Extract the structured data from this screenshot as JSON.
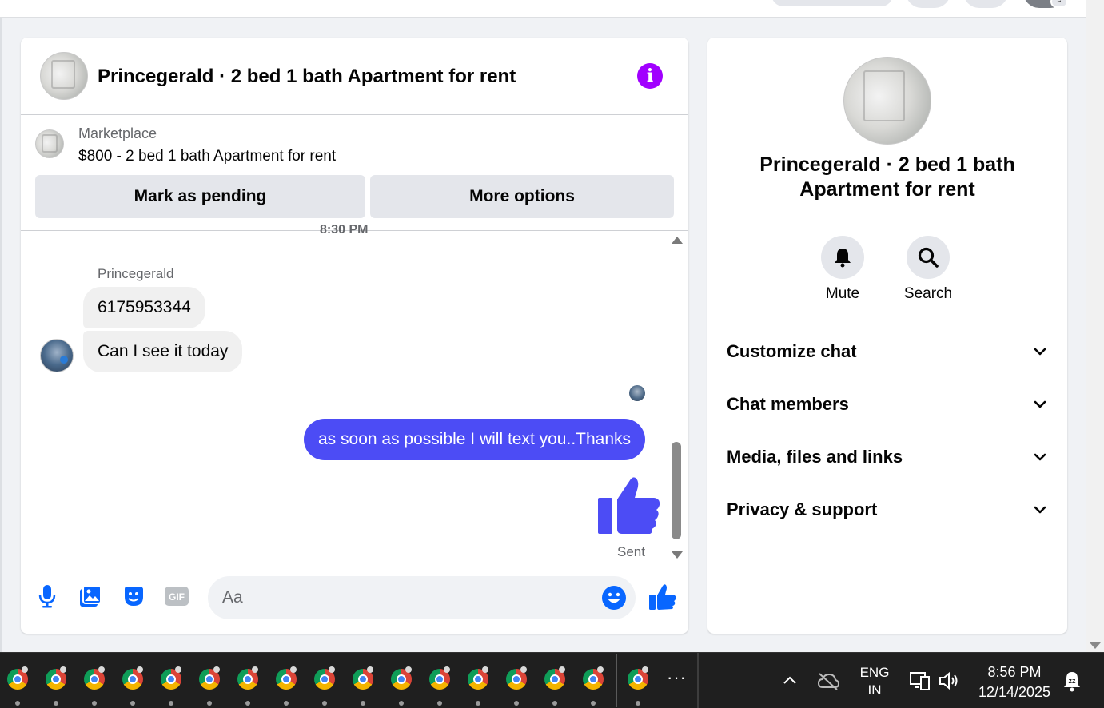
{
  "chat": {
    "title": "Princegerald · 2 bed 1 bath Apartment for rent",
    "listing": {
      "source": "Marketplace",
      "title": "$800 - 2 bed 1 bath Apartment for rent",
      "mark_pending_label": "Mark as pending",
      "more_options_label": "More options"
    },
    "time_divider": "8:30 PM",
    "messages": [
      {
        "sender": "Princegerald",
        "text": "6175953344",
        "direction": "incoming"
      },
      {
        "sender": "Princegerald",
        "text": "Can I see it today",
        "direction": "incoming"
      },
      {
        "sender": "me",
        "text": "as soon as possible I will text you..Thanks",
        "direction": "outgoing"
      },
      {
        "sender": "me",
        "text": "",
        "sticker": "thumbs-up",
        "direction": "outgoing"
      }
    ],
    "sender_name": "Princegerald",
    "status": "Sent",
    "composer": {
      "placeholder": "Aa",
      "tools": [
        "microphone-icon",
        "photo-icon",
        "sticker-icon",
        "gif-icon"
      ],
      "gif_label": "GIF"
    }
  },
  "info_panel": {
    "title": "Princegerald · 2 bed 1 bath Apartment for rent",
    "actions": [
      {
        "label": "Mute",
        "icon": "bell-icon"
      },
      {
        "label": "Search",
        "icon": "search-icon"
      }
    ],
    "sections": [
      {
        "label": "Customize chat"
      },
      {
        "label": "Chat members"
      },
      {
        "label": "Media, files and links"
      },
      {
        "label": "Privacy & support"
      }
    ]
  },
  "taskbar": {
    "app_icon": "chrome-icon",
    "app_count": 16,
    "more_label": "···",
    "language": "ENG",
    "region": "IN",
    "time": "8:56 PM",
    "date": "12/14/2025"
  },
  "colors": {
    "accent": "#4c4cf5",
    "messenger_blue": "#0866ff",
    "info_purple": "#a100ff",
    "bubble_in": "#f0f0f0",
    "taskbar": "#1f1f1f"
  }
}
